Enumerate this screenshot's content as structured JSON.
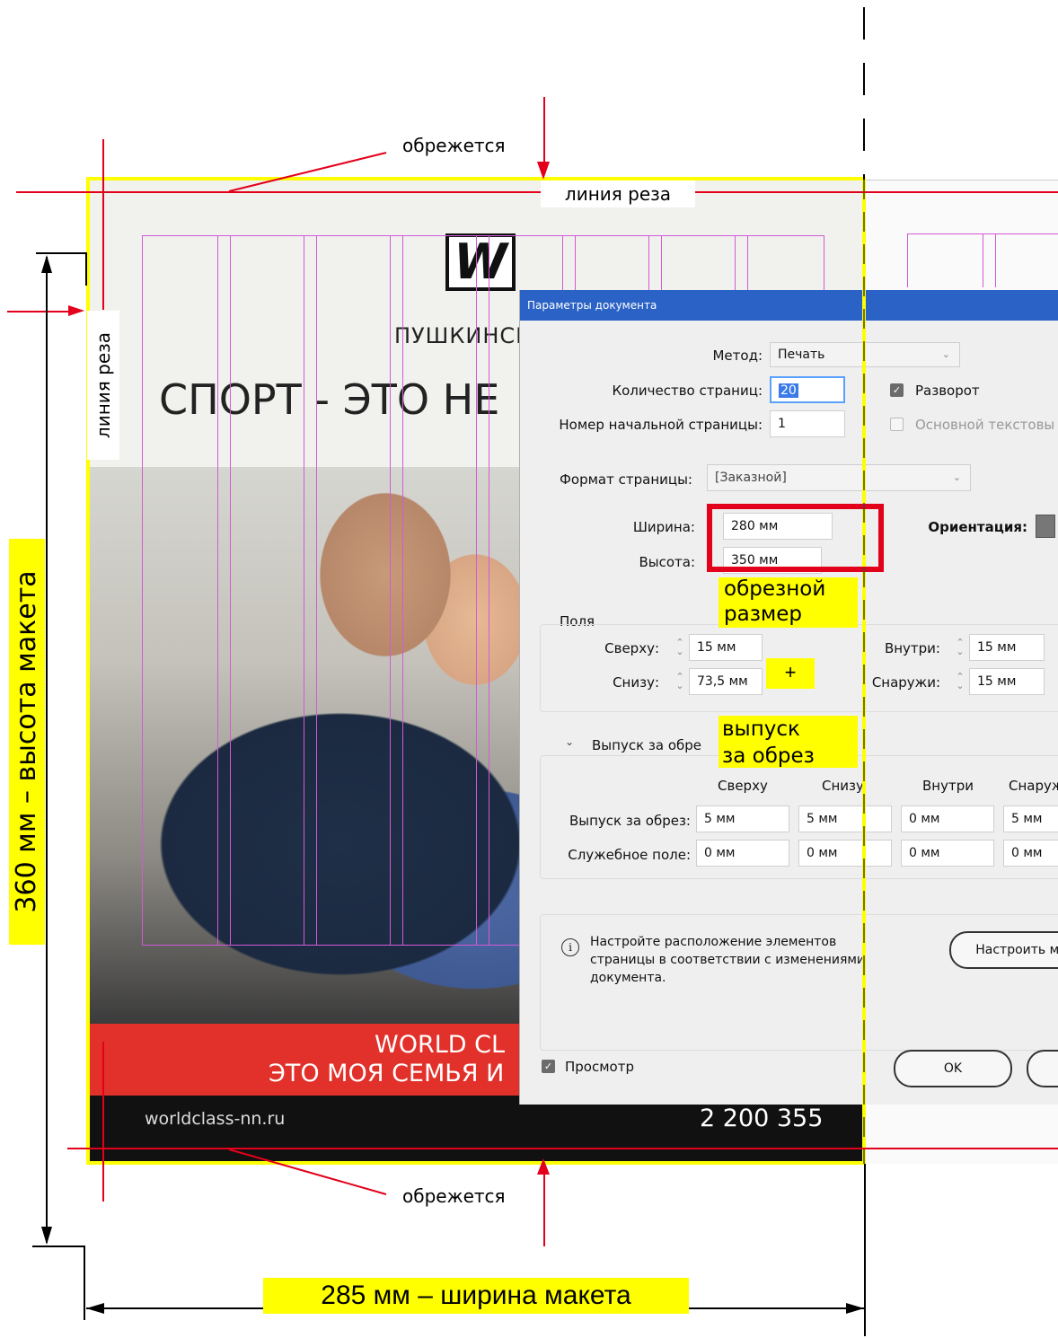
{
  "poster": {
    "logo_letter": "W",
    "club": "ПУШКИНСК",
    "headline": "СПОРТ - ЭТО НЕ",
    "band_line1": "WORLD CL",
    "band_line2": "ЭТО МОЯ СЕМЬЯ И",
    "website": "worldclass-nn.ru",
    "phone": "2 200 355"
  },
  "dialog": {
    "title": "Параметры документа",
    "method_label": "Метод:",
    "method_value": "Печать",
    "pages_label": "Количество страниц:",
    "pages_value": "20",
    "spread_label": "Разворот",
    "start_label": "Номер начальной страницы:",
    "start_value": "1",
    "primary_text_label": "Основной текстовы",
    "format_label": "Формат страницы:",
    "format_value": "[Заказной]",
    "width_label": "Ширина:",
    "width_value": "280 мм",
    "height_label": "Высота:",
    "height_value": "350 мм",
    "orientation_label": "Ориентация:",
    "margins": {
      "title": "Поля",
      "top_label": "Сверху:",
      "top_value": "15 мм",
      "bottom_label": "Снизу:",
      "bottom_value": "73,5 мм",
      "inside_label": "Внутри:",
      "inside_value": "15 мм",
      "outside_label": "Снаружи:",
      "outside_value": "15 мм"
    },
    "bleed": {
      "title": "Выпуск за обре",
      "col_top": "Сверху",
      "col_bottom": "Снизу",
      "col_inside": "Внутри",
      "col_outside": "Снаруж",
      "bleed_label": "Выпуск за обрез:",
      "bleed_values": [
        "5 мм",
        "5 мм",
        "0 мм",
        "5 мм"
      ],
      "slug_label": "Служебное поле:",
      "slug_values": [
        "0 мм",
        "0 мм",
        "0 мм",
        "0 мм"
      ]
    },
    "info_text_1": "Настройте расположение элементов",
    "info_text_2": "страницы в соответствии с изменениями",
    "info_text_3": "документа.",
    "adjust_button": "Настроить ма",
    "preview_label": "Просмотр",
    "ok_button": "OK"
  },
  "annotations": {
    "trim_top": "обрежется",
    "trim_bottom": "обрежется",
    "cut_line_top": "линия реза",
    "cut_line_left": "линия реза",
    "trim_size_1": "обрезной",
    "trim_size_2": "размер",
    "plus": "+",
    "bleed_1": "выпуск",
    "bleed_2": "за обрез",
    "height_dim": "360 мм – высота макета",
    "width_dim": "285 мм – ширина  макета"
  },
  "colors": {
    "annotation_red": "#e3001b",
    "highlight_yellow": "#ffff00",
    "guide_magenta": "#d35ad8",
    "dialog_title_blue": "#2a62c5",
    "poster_red": "#e2302a"
  }
}
